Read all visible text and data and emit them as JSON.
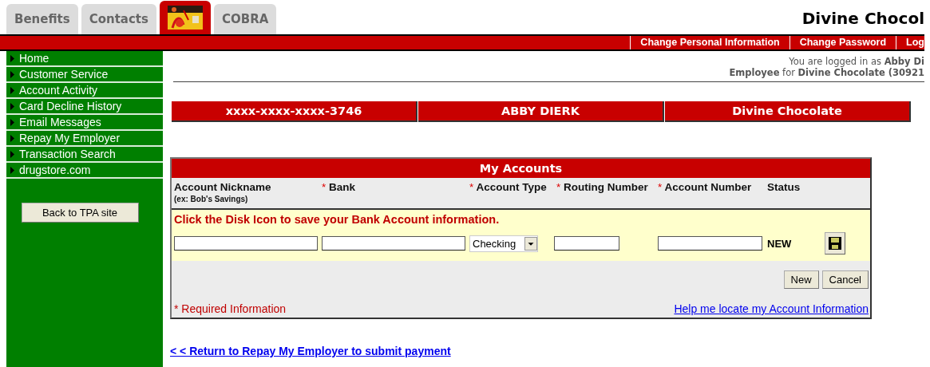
{
  "tabs": [
    {
      "kind": "text",
      "label": "Benefits",
      "selected": false
    },
    {
      "kind": "text",
      "label": "Contacts",
      "selected": false
    },
    {
      "kind": "picture",
      "selected": true
    },
    {
      "kind": "text",
      "label": "COBRA",
      "selected": false
    }
  ],
  "company_title": "Divine Chocol",
  "top_links": [
    "Change Personal Information",
    "Change Password",
    "Log"
  ],
  "login_info": [
    "You are logged in as **Abby Di**",
    "**Employee** for **Divine Chocolate (30921**"
  ],
  "sidebar": {
    "items": [
      "Home",
      "Customer Service",
      "Account Activity",
      "Card Decline History",
      "Email Messages",
      "Repay My Employer",
      "Transaction Search",
      "drugstore.com"
    ],
    "button": "Back to TPA site"
  },
  "info_boxes": [
    "xxxx-xxxx-xxxx-3746",
    "ABBY DIERK",
    "Divine Chocolate"
  ],
  "accounts": {
    "title": "My Accounts",
    "columns": [
      {
        "label": "Account Nickname",
        "hint": "(ex: Bob's Savings)"
      },
      {
        "mark": "*",
        "label": "Bank"
      },
      {
        "mark": "*",
        "label": "Account Type"
      },
      {
        "mark": "*",
        "label": "Routing Number"
      },
      {
        "mark": "*",
        "label": "Account Number"
      },
      {
        "label": "Status"
      }
    ],
    "notice": "Click the Disk Icon to save your Bank Account information.",
    "account_type": "Checking",
    "status": "NEW",
    "buttons": [
      "New",
      "Cancel"
    ],
    "required_note": "* Required Information",
    "help_link": "Help me locate my Account Information"
  },
  "return_link": "< < Return to Repay My Employer to submit payment"
}
